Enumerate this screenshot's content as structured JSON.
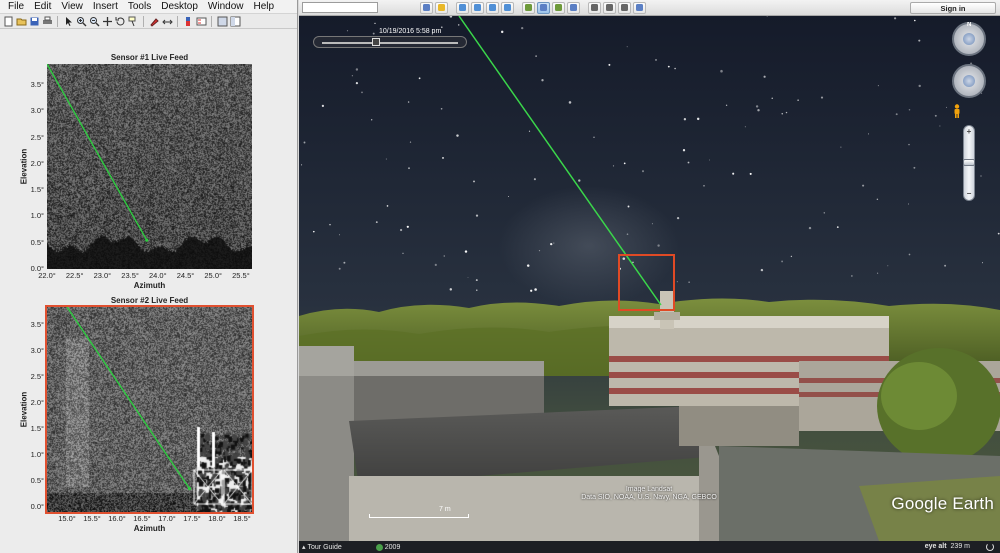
{
  "matlab": {
    "menu": [
      "File",
      "Edit",
      "View",
      "Insert",
      "Tools",
      "Desktop",
      "Window",
      "Help"
    ],
    "toolbar_icons": [
      "new-figure-icon",
      "open-file-icon",
      "save-icon",
      "print-icon",
      "pointer-icon",
      "zoom-in-icon",
      "zoom-out-icon",
      "pan-icon",
      "rotate-icon",
      "data-cursor-icon",
      "brush-icon",
      "link-icon",
      "colorbar-icon",
      "legend-icon",
      "hide-plot-tools-icon",
      "show-plot-tools-icon"
    ],
    "accent_color": "#e05030"
  },
  "chart_data": [
    {
      "type": "image",
      "title": "Sensor #1 Live Feed",
      "xlabel": "Azimuth",
      "ylabel": "Elevation",
      "xlim": [
        22.0,
        25.7
      ],
      "ylim": [
        0.0,
        3.9
      ],
      "xticks": [
        "22.0°",
        "22.5°",
        "23.0°",
        "23.5°",
        "24.0°",
        "24.5°",
        "25.0°",
        "25.5°"
      ],
      "xtick_values": [
        22.0,
        22.5,
        23.0,
        23.5,
        24.0,
        24.5,
        25.0,
        25.5
      ],
      "yticks": [
        "0.0°",
        "0.5°",
        "1.0°",
        "1.5°",
        "2.0°",
        "2.5°",
        "3.0°",
        "3.5°"
      ],
      "ytick_values": [
        0.0,
        0.5,
        1.0,
        1.5,
        2.0,
        2.5,
        3.0,
        3.5
      ],
      "track": {
        "color": "#2ecc40",
        "x": [
          22.0,
          23.8
        ],
        "y": [
          3.9,
          0.55
        ]
      },
      "selected": false
    },
    {
      "type": "image",
      "title": "Sensor #2 Live Feed",
      "xlabel": "Azimuth",
      "ylabel": "Elevation",
      "xlim": [
        14.6,
        18.7
      ],
      "ylim": [
        -0.1,
        3.85
      ],
      "xticks": [
        "15.0°",
        "15.5°",
        "16.0°",
        "16.5°",
        "17.0°",
        "17.5°",
        "18.0°",
        "18.5°"
      ],
      "xtick_values": [
        15.0,
        15.5,
        16.0,
        16.5,
        17.0,
        17.5,
        18.0,
        18.5
      ],
      "yticks": [
        "0.0°",
        "0.5°",
        "1.0°",
        "1.5°",
        "2.0°",
        "2.5°",
        "3.0°",
        "3.5°"
      ],
      "ytick_values": [
        0.0,
        0.5,
        1.0,
        1.5,
        2.0,
        2.5,
        3.0,
        3.5
      ],
      "track": {
        "color": "#2ecc40",
        "x": [
          15.0,
          17.45
        ],
        "y": [
          3.85,
          0.35
        ]
      },
      "selected": true
    }
  ],
  "earth": {
    "search_placeholder": "",
    "tool_icons": [
      "sidebar-icon",
      "placemark-icon",
      "polygon-icon",
      "path-icon",
      "image-overlay-icon",
      "record-tour-icon",
      "historical-imagery-icon",
      "sunlight-icon",
      "planets-icon",
      "ruler-icon",
      "email-icon",
      "print-icon",
      "save-image-icon",
      "maps-icon"
    ],
    "signin_label": "Sign in",
    "time_label": "10/19/2016   5:58 pm",
    "zoom_plus": "+",
    "zoom_minus": "−",
    "compass_n": "N",
    "attribution_line1": "Image Landsat",
    "attribution_line2": "Data SIO, NOAA, U.S. Navy, NGA, GEBCO",
    "scale_label": "7 m",
    "logo": "Google Earth",
    "tour_guide_label": "Tour Guide",
    "imagery_year": "2009",
    "eye_alt_label": "eye alt",
    "eye_alt_value": "239 m",
    "laser_color": "#3ad64a",
    "highlight_color": "#e04a25"
  }
}
